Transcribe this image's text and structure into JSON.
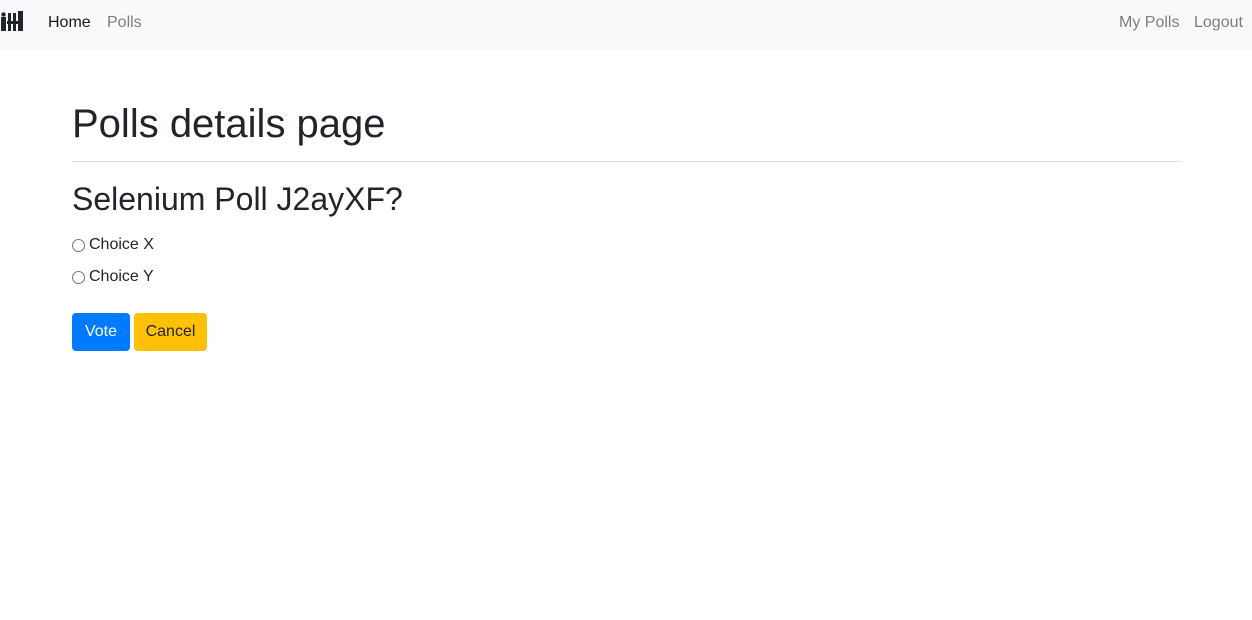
{
  "navbar": {
    "brand_icon": "polls-logo-icon",
    "links": [
      {
        "label": "Home",
        "active": true
      },
      {
        "label": "Polls",
        "active": false
      }
    ],
    "right_links": [
      {
        "label": "My Polls"
      },
      {
        "label": "Logout"
      }
    ]
  },
  "main": {
    "title": "Polls details page",
    "question": "Selenium Poll J2ayXF?",
    "choices": [
      {
        "label": "Choice X",
        "selected": false
      },
      {
        "label": "Choice Y",
        "selected": false
      }
    ],
    "vote_label": "Vote",
    "cancel_label": "Cancel"
  },
  "colors": {
    "navbar_bg": "#f8f9fa",
    "primary": "#007bff",
    "warning": "#ffc107",
    "text": "#212529"
  }
}
